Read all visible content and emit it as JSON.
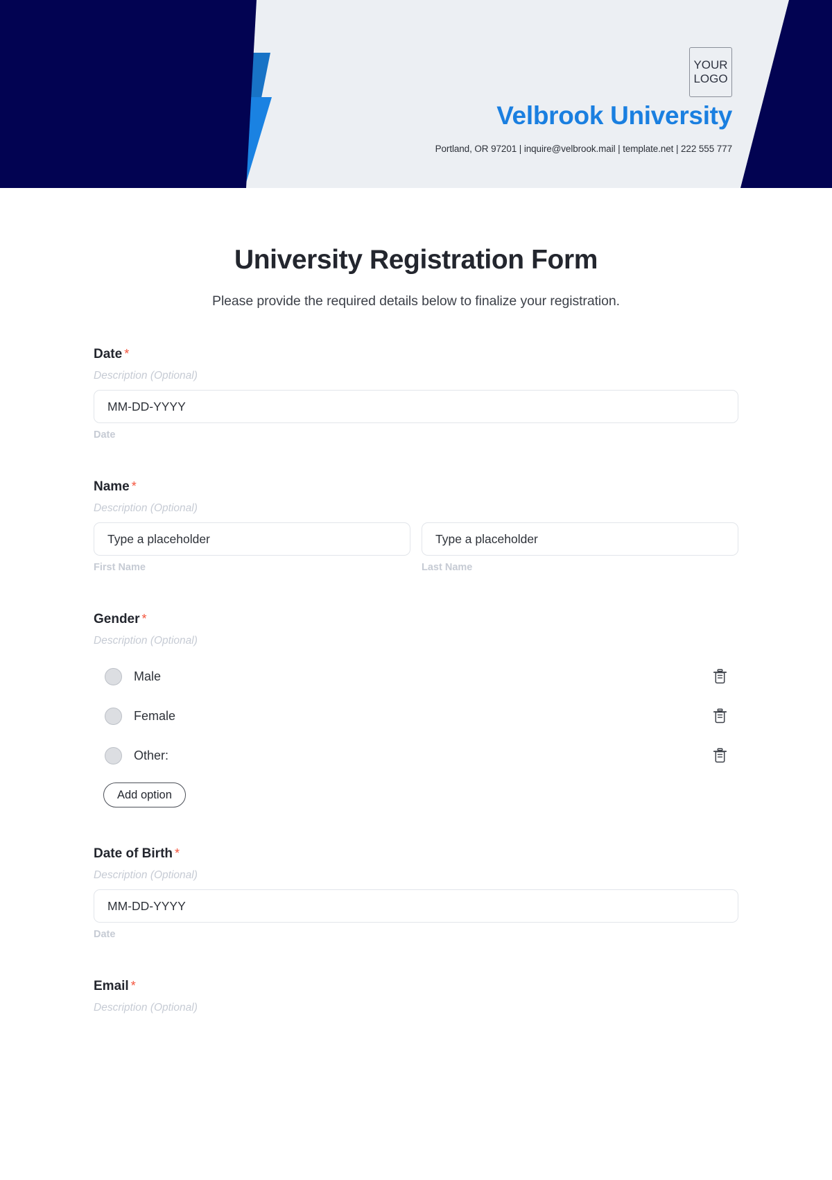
{
  "header": {
    "logo_line1": "YOUR",
    "logo_line2": "LOGO",
    "org_name": "Velbrook University",
    "contact": "Portland, OR 97201 | inquire@velbrook.mail | template.net | 222 555 777",
    "colors": {
      "navy": "#020352",
      "blue": "#1a82e2",
      "blue_mid": "#1668ba",
      "bg": "#eceff3",
      "title": "#1a7fe0"
    }
  },
  "form": {
    "title": "University Registration Form",
    "subtitle": "Please provide the required details below to finalize your registration.",
    "required_marker": "*",
    "description_placeholder": "Description (Optional)",
    "add_option_label": "Add option",
    "fields": [
      {
        "label": "Date",
        "description": "Description (Optional)",
        "value": "MM-DD-YYYY",
        "hint": "Date"
      },
      {
        "label": "Name",
        "description": "Description (Optional)",
        "first_value": "Type a placeholder",
        "first_hint": "First Name",
        "last_value": "Type a placeholder",
        "last_hint": "Last Name"
      },
      {
        "label": "Gender",
        "description": "Description (Optional)",
        "options": [
          {
            "label": "Male",
            "delete_icon": "trash-icon"
          },
          {
            "label": "Female",
            "delete_icon": "trash-icon"
          },
          {
            "label": "Other:",
            "delete_icon": "trash-icon"
          }
        ]
      },
      {
        "label": "Date of Birth",
        "description": "Description (Optional)",
        "value": "MM-DD-YYYY",
        "hint": "Date"
      },
      {
        "label": "Email",
        "description": "Description (Optional)"
      }
    ]
  }
}
